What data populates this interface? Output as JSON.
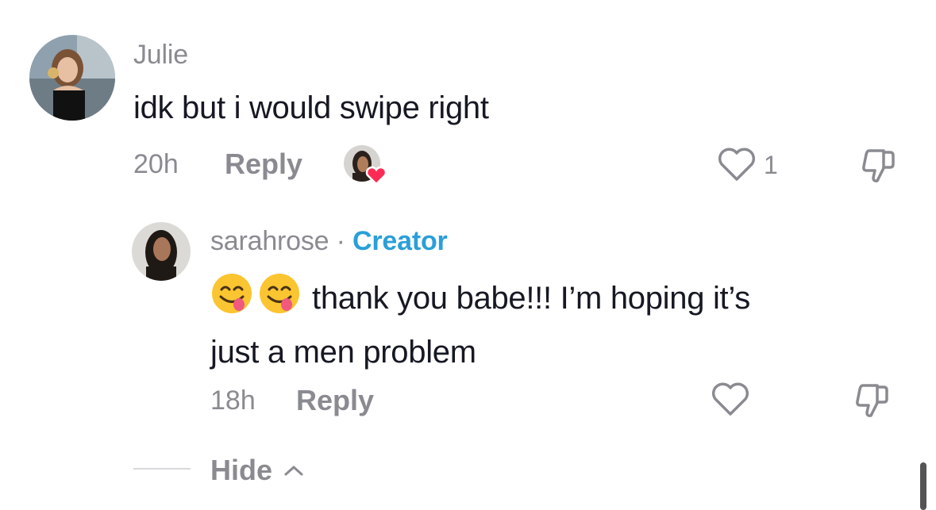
{
  "comment": {
    "username": "Julie",
    "text": "idk but i would swipe right",
    "time": "20h",
    "reply_label": "Reply",
    "like_count": "1",
    "icons": {
      "avatar": "user-avatar",
      "liked_by_creator": "creator-heart-avatar",
      "like": "heart-outline-icon",
      "dislike": "thumbs-down-icon"
    }
  },
  "reply": {
    "username": "sarahrose",
    "separator": " · ",
    "badge": "Creator",
    "text_line1": "thank you babe!!! I’m hoping it’s",
    "text_line2": "just a men problem",
    "emoji": [
      "😋",
      "😋"
    ],
    "time": "18h",
    "reply_label": "Reply",
    "icons": {
      "avatar": "user-avatar",
      "like": "heart-outline-icon",
      "dislike": "thumbs-down-icon"
    }
  },
  "thread": {
    "hide_label": "Hide",
    "hide_icon": "chevron-up-icon"
  },
  "colors": {
    "muted": "#8a8b91",
    "text": "#161823",
    "creator": "#2b9fd9",
    "heart": "#fe2c55"
  }
}
